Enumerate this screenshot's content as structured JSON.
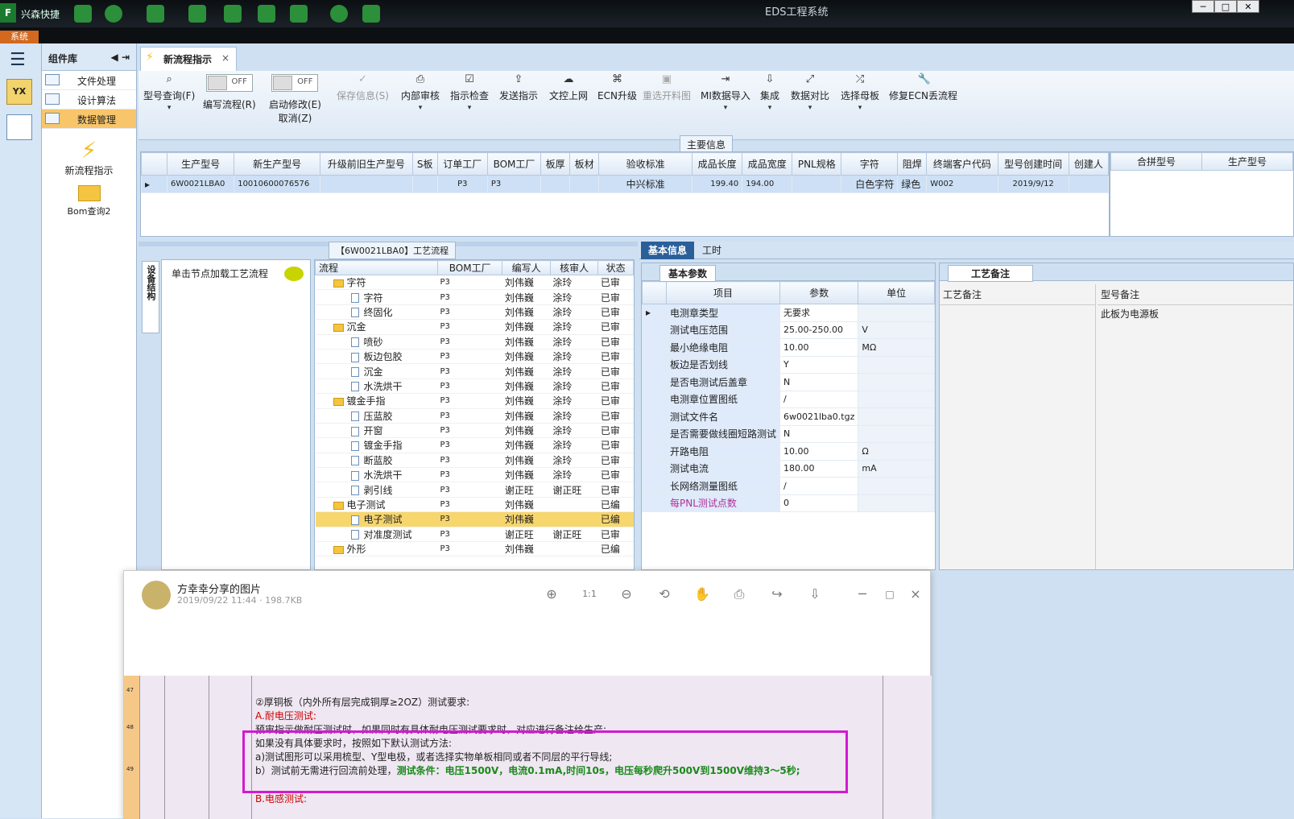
{
  "titlebar": {
    "app_title": "EDS工程系统",
    "company": "兴森快捷",
    "system_tab": "系统"
  },
  "components": {
    "header": "组件库",
    "items": [
      {
        "label": "文件处理"
      },
      {
        "label": "设计算法"
      },
      {
        "label": "数据管理"
      }
    ],
    "big_items": [
      {
        "label": "新流程指示"
      },
      {
        "label": "Bom查询2"
      }
    ]
  },
  "tab": {
    "label": "新流程指示"
  },
  "ribbon": {
    "buttons": [
      {
        "label": "型号查询(F)"
      },
      {
        "label": "编写流程(R)",
        "toggle": "OFF"
      },
      {
        "label": "启动修改(E)",
        "sub": "取消(Z)",
        "toggle": "OFF"
      },
      {
        "label": "保存信息(S)"
      },
      {
        "label": "内部审核"
      },
      {
        "label": "指示检查"
      },
      {
        "label": "发送指示"
      },
      {
        "label": "文控上网"
      },
      {
        "label": "ECN升级"
      },
      {
        "label": "重选开料图"
      },
      {
        "label": "MI数据导入"
      },
      {
        "label": "集成"
      },
      {
        "label": "数据对比"
      },
      {
        "label": "选择母板"
      },
      {
        "label": "修复ECN丢流程"
      }
    ]
  },
  "main_info": {
    "title": "主要信息",
    "columns": [
      "生产型号",
      "新生产型号",
      "升级前旧生产型号",
      "S板",
      "订单工厂",
      "BOM工厂",
      "板厚",
      "板材",
      "验收标准",
      "成品长度",
      "成品宽度",
      "PNL规格",
      "字符",
      "阻焊",
      "终端客户代码",
      "型号创建时间",
      "创建人"
    ],
    "row": [
      "6W0021LBA0",
      "10010600076576",
      "",
      "",
      "P3",
      "P3",
      "",
      "",
      "中兴标准",
      "199.40",
      "194.00",
      "",
      "白色字符",
      "绿色",
      "W002",
      "2019/9/12",
      ""
    ],
    "side_columns": [
      "合拼型号",
      "生产型号"
    ]
  },
  "process": {
    "title": "【6W0021LBA0】工艺流程",
    "hint": "单击节点加载工艺流程",
    "side_tab": "设备结构",
    "columns": [
      "流程",
      "BOM工厂",
      "编写人",
      "核审人",
      "状态"
    ],
    "rows": [
      {
        "name": "字符",
        "level": 0,
        "factory": "P3",
        "writer": "刘伟巍",
        "reviewer": "涂玲",
        "status": "已审"
      },
      {
        "name": "字符",
        "level": 1,
        "factory": "P3",
        "writer": "刘伟巍",
        "reviewer": "涂玲",
        "status": "已审"
      },
      {
        "name": "终固化",
        "level": 1,
        "factory": "P3",
        "writer": "刘伟巍",
        "reviewer": "涂玲",
        "status": "已审"
      },
      {
        "name": "沉金",
        "level": 0,
        "factory": "P3",
        "writer": "刘伟巍",
        "reviewer": "涂玲",
        "status": "已审"
      },
      {
        "name": "喷砂",
        "level": 1,
        "factory": "P3",
        "writer": "刘伟巍",
        "reviewer": "涂玲",
        "status": "已审"
      },
      {
        "name": "板边包胶",
        "level": 1,
        "factory": "P3",
        "writer": "刘伟巍",
        "reviewer": "涂玲",
        "status": "已审"
      },
      {
        "name": "沉金",
        "level": 1,
        "factory": "P3",
        "writer": "刘伟巍",
        "reviewer": "涂玲",
        "status": "已审"
      },
      {
        "name": "水洗烘干",
        "level": 1,
        "factory": "P3",
        "writer": "刘伟巍",
        "reviewer": "涂玲",
        "status": "已审"
      },
      {
        "name": "镀金手指",
        "level": 0,
        "factory": "P3",
        "writer": "刘伟巍",
        "reviewer": "涂玲",
        "status": "已审"
      },
      {
        "name": "压蓝胶",
        "level": 1,
        "factory": "P3",
        "writer": "刘伟巍",
        "reviewer": "涂玲",
        "status": "已审"
      },
      {
        "name": "开窗",
        "level": 1,
        "factory": "P3",
        "writer": "刘伟巍",
        "reviewer": "涂玲",
        "status": "已审"
      },
      {
        "name": "镀金手指",
        "level": 1,
        "factory": "P3",
        "writer": "刘伟巍",
        "reviewer": "涂玲",
        "status": "已审"
      },
      {
        "name": "断蓝胶",
        "level": 1,
        "factory": "P3",
        "writer": "刘伟巍",
        "reviewer": "涂玲",
        "status": "已审"
      },
      {
        "name": "水洗烘干",
        "level": 1,
        "factory": "P3",
        "writer": "刘伟巍",
        "reviewer": "涂玲",
        "status": "已审"
      },
      {
        "name": "剥引线",
        "level": 1,
        "factory": "P3",
        "writer": "谢正旺",
        "reviewer": "谢正旺",
        "status": "已审"
      },
      {
        "name": "电子测试",
        "level": 0,
        "factory": "P3",
        "writer": "刘伟巍",
        "reviewer": "",
        "status": "已编"
      },
      {
        "name": "电子测试",
        "level": 1,
        "factory": "P3",
        "writer": "刘伟巍",
        "reviewer": "",
        "status": "已编",
        "selected": true
      },
      {
        "name": "对准度测试",
        "level": 1,
        "factory": "P3",
        "writer": "谢正旺",
        "reviewer": "谢正旺",
        "status": "已审"
      },
      {
        "name": "外形",
        "level": 0,
        "factory": "P3",
        "writer": "刘伟巍",
        "reviewer": "",
        "status": "已编"
      }
    ]
  },
  "basic": {
    "tabs": [
      "基本信息",
      "工时"
    ],
    "section": "基本参数",
    "columns": [
      "项目",
      "参数",
      "单位"
    ],
    "rows": [
      {
        "item": "电测章类型",
        "value": "无要求",
        "unit": ""
      },
      {
        "item": "测试电压范围",
        "value": "25.00-250.00",
        "unit": "V"
      },
      {
        "item": "最小绝缘电阻",
        "value": "10.00",
        "unit": "MΩ"
      },
      {
        "item": "板边是否划线",
        "value": "Y",
        "unit": ""
      },
      {
        "item": "是否电测试后盖章",
        "value": "N",
        "unit": ""
      },
      {
        "item": "电测章位置图纸",
        "value": "/",
        "unit": ""
      },
      {
        "item": "测试文件名",
        "value": "6w0021lba0.tgz",
        "unit": ""
      },
      {
        "item": "是否需要做线圈短路测试",
        "value": "N",
        "unit": ""
      },
      {
        "item": "开路电阻",
        "value": "10.00",
        "unit": "Ω"
      },
      {
        "item": "测试电流",
        "value": "180.00",
        "unit": "mA"
      },
      {
        "item": "长网络测量图纸",
        "value": "/",
        "unit": ""
      },
      {
        "item": "每PNL测试点数",
        "value": "0",
        "unit": ""
      }
    ]
  },
  "notes": {
    "title": "工艺备注",
    "col1": "工艺备注",
    "col2": "型号备注",
    "value2": "此板为电源板"
  },
  "viewer": {
    "title": "方幸幸分享的图片",
    "meta": "2019/09/22 11:44 · 198.7KB",
    "row_numbers": [
      "47",
      "48",
      "49"
    ],
    "lines": [
      "②厚铜板（内外所有层完成铜厚≥2OZ）测试要求:",
      "A.耐电压测试:",
      "预审指示做耐压测试时，如果同时有具体耐电压测试要求时，对应进行备注给生产:",
      "如果没有具体要求时，按照如下默认测试方法:",
      "a)测试图形可以采用梳型、Y型电极，或者选择实物单板相同或者不同层的平行导线;",
      "b）测试前无需进行回流前处理，",
      "测试条件：电压1500V，电流0.1mA,时间10s，电压每秒爬升500V到1500V维持3～5秒;",
      "B.电感测试:"
    ]
  }
}
